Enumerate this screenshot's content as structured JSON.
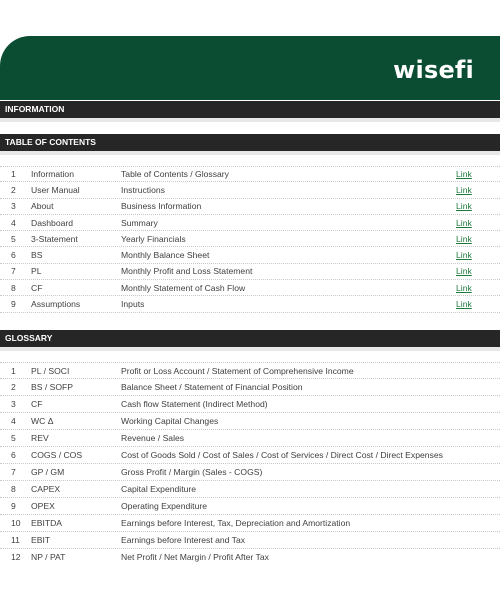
{
  "brand": {
    "logo_text": "wisefi"
  },
  "sections": {
    "information": "INFORMATION",
    "toc": "TABLE OF CONTENTS",
    "glossary": "GLOSSARY"
  },
  "toc": [
    {
      "num": "1",
      "code": "Information",
      "desc": "Table of Contents / Glossary",
      "link": "Link"
    },
    {
      "num": "2",
      "code": "User Manual",
      "desc": "Instructions",
      "link": "Link"
    },
    {
      "num": "3",
      "code": "About",
      "desc": "Business Information",
      "link": "Link"
    },
    {
      "num": "4",
      "code": "Dashboard",
      "desc": "Summary",
      "link": "Link"
    },
    {
      "num": "5",
      "code": "3-Statement",
      "desc": "Yearly Financials",
      "link": "Link"
    },
    {
      "num": "6",
      "code": "BS",
      "desc": "Monthly Balance Sheet",
      "link": "Link"
    },
    {
      "num": "7",
      "code": "PL",
      "desc": "Monthly Profit and Loss Statement",
      "link": "Link"
    },
    {
      "num": "8",
      "code": "CF",
      "desc": "Monthly Statement of Cash Flow",
      "link": "Link"
    },
    {
      "num": "9",
      "code": "Assumptions",
      "desc": "Inputs",
      "link": "Link"
    }
  ],
  "glossary": [
    {
      "num": "1",
      "code": "PL / SOCI",
      "desc": "Profit or Loss Account /  Statement of Comprehensive Income"
    },
    {
      "num": "2",
      "code": "BS / SOFP",
      "desc": "Balance Sheet / Statement of Financial Position"
    },
    {
      "num": "3",
      "code": "CF",
      "desc": "Cash flow Statement (Indirect Method)"
    },
    {
      "num": "4",
      "code": "WC Δ",
      "desc": "Working Capital Changes"
    },
    {
      "num": "5",
      "code": "REV",
      "desc": "Revenue / Sales"
    },
    {
      "num": "6",
      "code": "COGS / COS",
      "desc": "Cost of Goods Sold / Cost of Sales / Cost of Services / Direct Cost / Direct Expenses"
    },
    {
      "num": "7",
      "code": "GP / GM",
      "desc": "Gross Profit / Margin (Sales - COGS)"
    },
    {
      "num": "8",
      "code": "CAPEX",
      "desc": "Capital Expenditure"
    },
    {
      "num": "9",
      "code": "OPEX",
      "desc": "Operating Expenditure"
    },
    {
      "num": "10",
      "code": "EBITDA",
      "desc": "Earnings before Interest, Tax, Depreciation and Amortization"
    },
    {
      "num": "11",
      "code": "EBIT",
      "desc": "Earnings before Interest and Tax"
    },
    {
      "num": "12",
      "code": "NP / PAT",
      "desc": "Net Profit / Net Margin / Profit After Tax"
    }
  ]
}
